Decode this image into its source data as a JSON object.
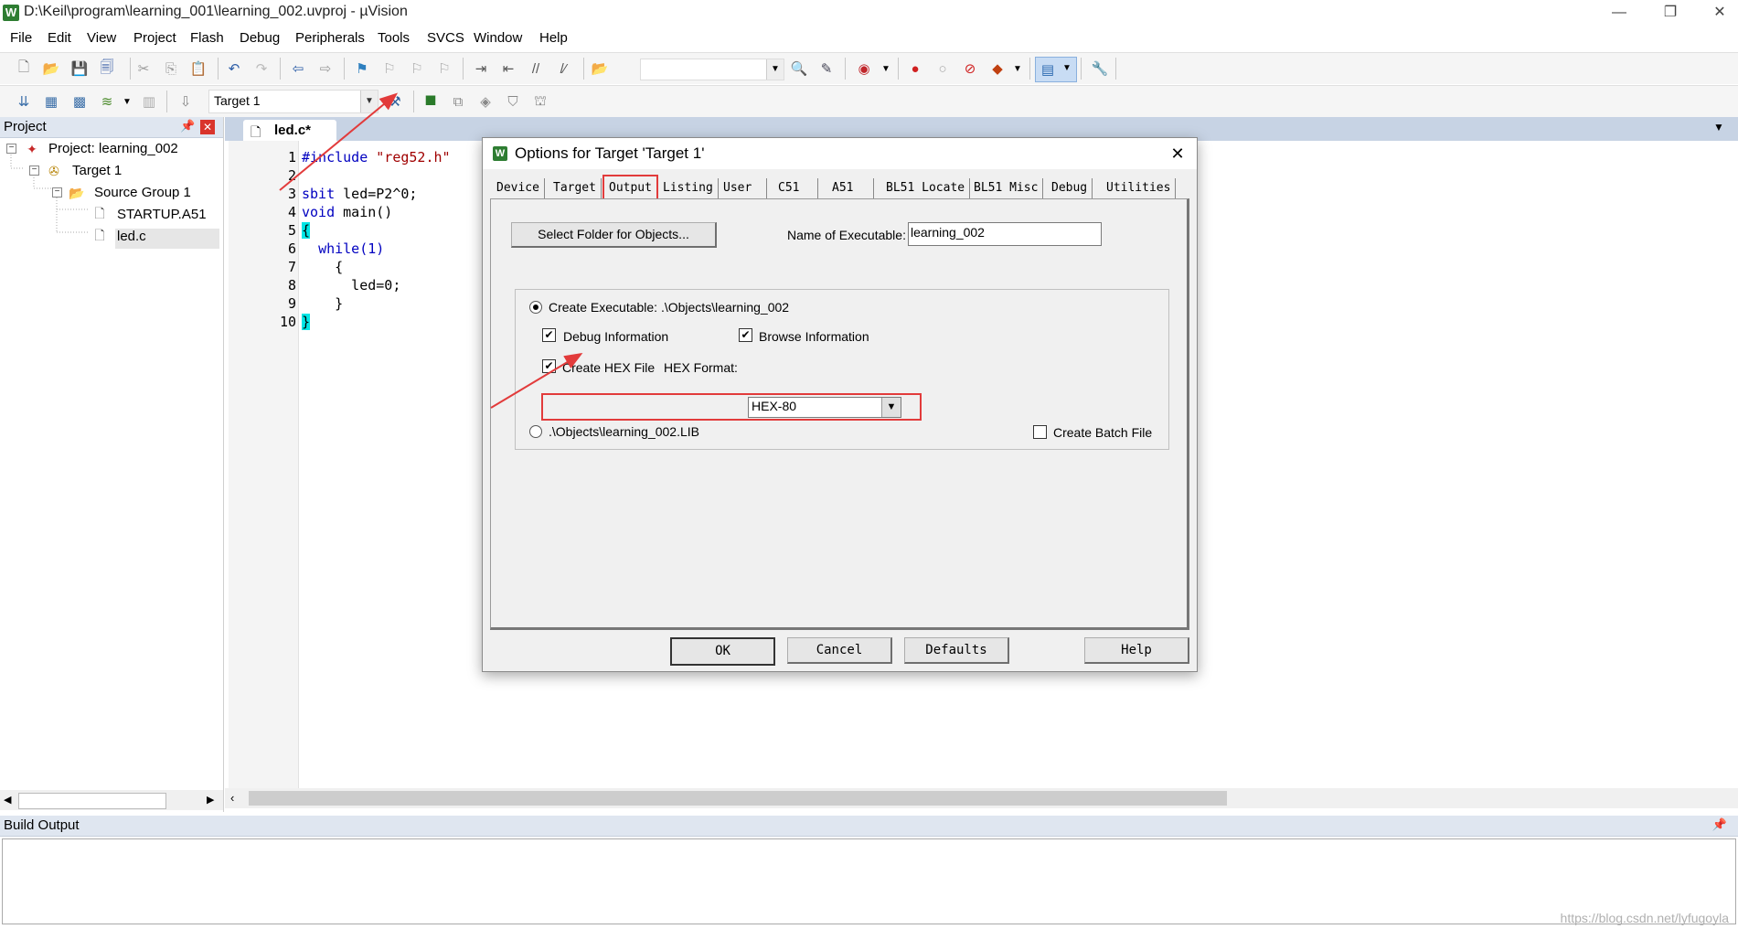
{
  "window": {
    "title": "D:\\Keil\\program\\learning_001\\learning_002.uvproj - µVision",
    "icon_letter": "W",
    "controls": [
      "—",
      "❐",
      "✕"
    ]
  },
  "menu": [
    "File",
    "Edit",
    "View",
    "Project",
    "Flash",
    "Debug",
    "Peripherals",
    "Tools",
    "SVCS",
    "Window",
    "Help"
  ],
  "toolbar2": {
    "target_select": "Target 1"
  },
  "project_panel": {
    "title": "Project",
    "tree": [
      {
        "label": "Project: learning_002",
        "icon": "project-icon"
      },
      {
        "label": "Target 1",
        "icon": "target-icon"
      },
      {
        "label": "Source Group 1",
        "icon": "folder-icon"
      },
      {
        "label": "STARTUP.A51",
        "icon": "file-icon"
      },
      {
        "label": "led.c",
        "icon": "file-icon",
        "selected": true
      }
    ]
  },
  "editor": {
    "tab_label": "led.c*",
    "lines": [
      {
        "n": "1",
        "text": "#include \"reg52.h\""
      },
      {
        "n": "2",
        "text": ""
      },
      {
        "n": "3",
        "text": "sbit led=P2^0;"
      },
      {
        "n": "4",
        "text": "void main()"
      },
      {
        "n": "5",
        "text": "{"
      },
      {
        "n": "6",
        "text": "  while(1)"
      },
      {
        "n": "7",
        "text": "    {"
      },
      {
        "n": "8",
        "text": "      led=0;"
      },
      {
        "n": "9",
        "text": "    }"
      },
      {
        "n": "10",
        "text": "}"
      }
    ]
  },
  "build_output": {
    "title": "Build Output"
  },
  "dialog": {
    "title": "Options for Target 'Target 1'",
    "tabs": [
      "Device",
      "Target",
      "Output",
      "Listing",
      "User",
      "C51",
      "A51",
      "BL51 Locate",
      "BL51 Misc",
      "Debug",
      "Utilities"
    ],
    "active_tab": "Output",
    "select_folder_button": "Select Folder for Objects...",
    "name_of_executable_label": "Name of Executable:",
    "name_of_executable_value": "learning_002",
    "create_executable_label": "Create Executable:  .\\Objects\\learning_002",
    "debug_information_label": "Debug Information",
    "debug_information_checked": true,
    "browse_information_label": "Browse Information",
    "browse_information_checked": true,
    "create_hex_label": "Create HEX File",
    "create_hex_checked": true,
    "hex_format_label": "HEX Format:",
    "hex_format_value": "HEX-80",
    "create_library_label": ".\\Objects\\learning_002.LIB",
    "create_batch_label": "Create Batch File",
    "create_batch_checked": false,
    "buttons": {
      "ok": "OK",
      "cancel": "Cancel",
      "defaults": "Defaults",
      "help": "Help"
    }
  },
  "annotation_color": "#e23b3b",
  "watermark": "https://blog.csdn.net/lyfugoyla"
}
